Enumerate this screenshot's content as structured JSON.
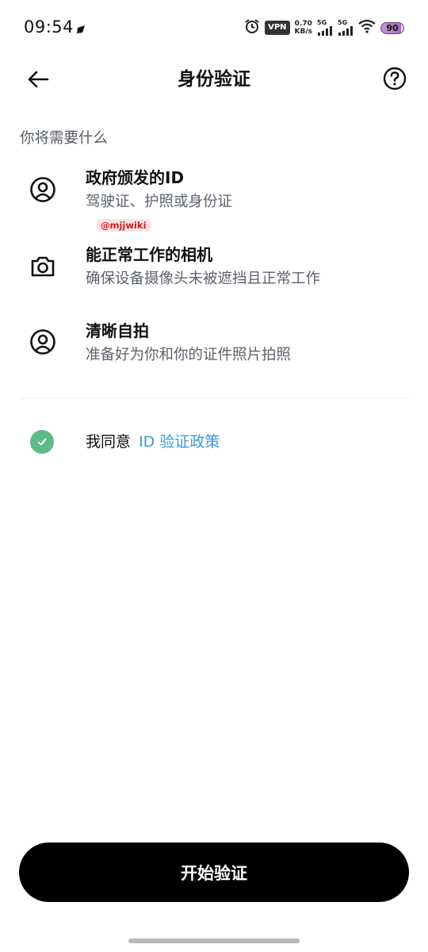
{
  "status_bar": {
    "time": "09:54",
    "vpn": "VPN",
    "net_speed_value": "0.70",
    "net_speed_unit": "KB/s",
    "sim1": "5G",
    "sim2": "5G",
    "battery": "90"
  },
  "header": {
    "title": "身份验证",
    "back_icon": "arrow-left-icon",
    "help_icon": "question-circle-icon"
  },
  "section_heading": "你将需要什么",
  "requirements": [
    {
      "icon": "user-circle-icon",
      "title": "政府颁发的ID",
      "description": "驾驶证、护照或身份证"
    },
    {
      "icon": "camera-icon",
      "title": "能正常工作的相机",
      "description": "确保设备摄像头未被遮挡且正常工作"
    },
    {
      "icon": "user-circle-icon",
      "title": "清晰自拍",
      "description": "准备好为你和你的证件照片拍照"
    }
  ],
  "watermark": "@mjjwiki",
  "agreement": {
    "checked": true,
    "prefix": "我同意",
    "link": "ID 验证政策"
  },
  "start_button": "开始验证",
  "colors": {
    "accent_link": "#3a9ad9",
    "check_green": "#5dbb87",
    "button_bg": "#000000"
  }
}
